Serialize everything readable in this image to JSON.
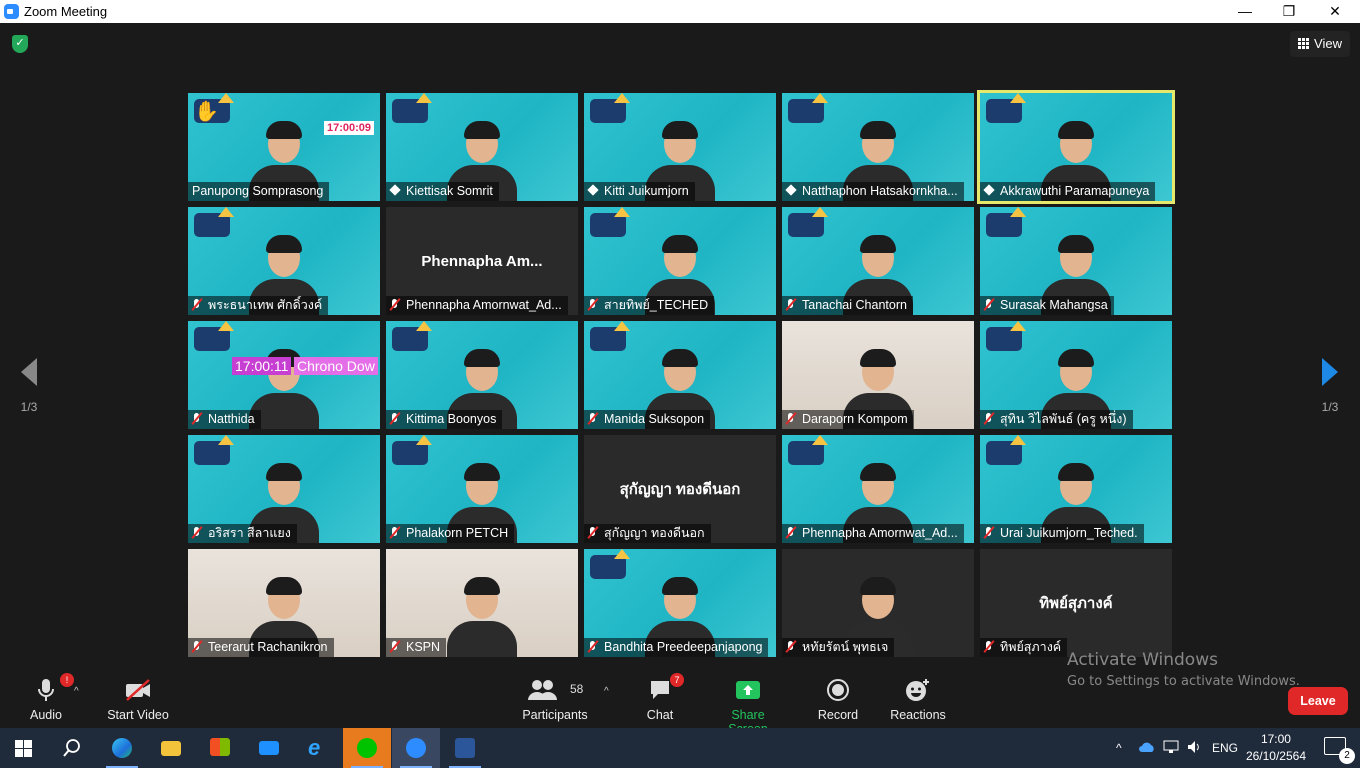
{
  "window": {
    "title": "Zoom Meeting"
  },
  "header": {
    "view_label": "View"
  },
  "pager": {
    "left_label": "1/3",
    "right_label": "1/3"
  },
  "tiles": [
    {
      "name": "Panupong Somprasong",
      "bg": "teal",
      "mic": "none",
      "extra": "hand-clock",
      "clock": "17:00:09"
    },
    {
      "name": "Kiettisak Somrit",
      "bg": "teal",
      "mic": "pin"
    },
    {
      "name": "Kitti Juikumjorn",
      "bg": "teal",
      "mic": "pin"
    },
    {
      "name": "Natthaphon Hatsakornkha...",
      "bg": "teal",
      "mic": "pin"
    },
    {
      "name": "Akkrawuthi Paramapuneya",
      "bg": "teal",
      "mic": "pin",
      "active": true
    },
    {
      "name": "พระธนาเทพ ศักดิ์วงค์",
      "bg": "teal",
      "mic": "muted"
    },
    {
      "name": "Phennapha Amornwat_Ad...",
      "bg": "dark",
      "mic": "muted",
      "big": "Phennapha  Am..."
    },
    {
      "name": "สายทิพย์_TECHED",
      "bg": "teal",
      "mic": "muted"
    },
    {
      "name": "Tanachai Chantorn",
      "bg": "teal",
      "mic": "muted"
    },
    {
      "name": "Surasak Mahangsa",
      "bg": "teal",
      "mic": "muted"
    },
    {
      "name": "Natthida",
      "bg": "teal",
      "mic": "muted",
      "extra": "chrono",
      "clock": "17:00:11",
      "chrono": "Chrono Dow"
    },
    {
      "name": "Kittima Boonyos",
      "bg": "teal",
      "mic": "muted"
    },
    {
      "name": "Manida Suksopon",
      "bg": "teal",
      "mic": "muted"
    },
    {
      "name": "Daraporn Kompom",
      "bg": "room",
      "mic": "muted"
    },
    {
      "name": "สุทิน วิไลพันธ์ (ครู หนึ่ง)",
      "bg": "teal",
      "mic": "muted"
    },
    {
      "name": "อริสรา สีลาแยง",
      "bg": "teal",
      "mic": "muted"
    },
    {
      "name": "Phalakorn PETCH",
      "bg": "teal",
      "mic": "muted"
    },
    {
      "name": "สุกัญญา ทองดีนอก",
      "bg": "dark",
      "mic": "muted",
      "big": "สุกัญญา ทองดีนอก"
    },
    {
      "name": "Phennapha Amornwat_Ad...",
      "bg": "teal",
      "mic": "muted"
    },
    {
      "name": "Urai Juikumjorn_Teched.",
      "bg": "teal",
      "mic": "muted"
    },
    {
      "name": "Teerarut Rachanikron",
      "bg": "room",
      "mic": "muted"
    },
    {
      "name": "KSPN",
      "bg": "room",
      "mic": "muted"
    },
    {
      "name": "Bandhita Preedeepanjapong",
      "bg": "teal",
      "mic": "muted"
    },
    {
      "name": "หทัยรัตน์ พุทธเจ",
      "bg": "dark",
      "mic": "muted"
    },
    {
      "name": "ทิพย์สุภางค์",
      "bg": "dark",
      "mic": "muted",
      "big": "ทิพย์สุภางค์"
    }
  ],
  "toolbar": {
    "audio_label": "Audio",
    "audio_badge": "!",
    "video_label": "Start Video",
    "participants_label": "Participants",
    "participants_count": "58",
    "chat_label": "Chat",
    "chat_badge": "7",
    "share_label": "Share Screen",
    "record_label": "Record",
    "reactions_label": "Reactions",
    "leave_label": "Leave"
  },
  "watermark": {
    "line1": "Activate Windows",
    "line2": "Go to Settings to activate Windows."
  },
  "taskbar": {
    "lang": "ENG",
    "time": "17:00",
    "date": "26/10/2564",
    "notifications": "2",
    "apps": [
      "windows-start",
      "search",
      "edge",
      "file-explorer",
      "store",
      "mail",
      "internet-explorer",
      "line",
      "zoom",
      "word"
    ]
  },
  "colors": {
    "accent": "#2d8cff",
    "share": "#23c45e",
    "leave": "#e02828",
    "teal_bg": "#2bbfcc",
    "active_outline": "#e6e86c"
  }
}
